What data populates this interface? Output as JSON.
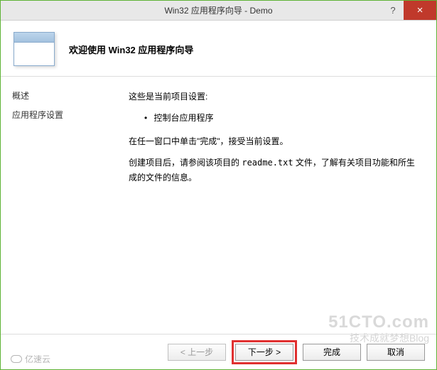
{
  "titlebar": {
    "title": "Win32 应用程序向导 - Demo",
    "help": "?",
    "close": "×"
  },
  "header": {
    "title": "欢迎使用 Win32 应用程序向导"
  },
  "sidebar": {
    "items": [
      {
        "label": "概述"
      },
      {
        "label": "应用程序设置"
      }
    ]
  },
  "content": {
    "intro": "这些是当前项目设置:",
    "bullets": [
      "控制台应用程序"
    ],
    "line2": "在任一窗口中单击\"完成\"，接受当前设置。",
    "line3_pre": "创建项目后，请参阅该项目的 ",
    "readme": "readme.txt",
    "line3_post": " 文件，了解有关项目功能和所生成的文件的信息。"
  },
  "buttons": {
    "prev": "< 上一步",
    "next": "下一步 >",
    "finish": "完成",
    "cancel": "取消"
  },
  "watermarks": {
    "w1": "51CTO.com",
    "w2": "技术成就梦想Blog",
    "w3": "亿速云"
  }
}
